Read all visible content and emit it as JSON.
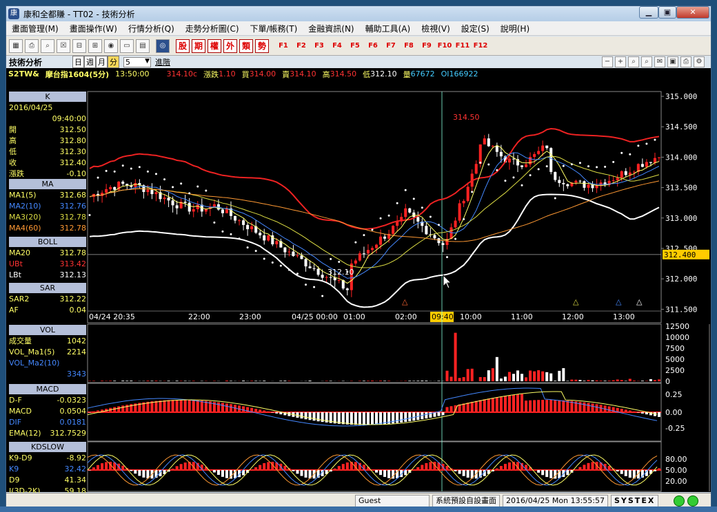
{
  "window": {
    "title": "康和全都賺 - TT02 - 技術分析",
    "app_icon": "康"
  },
  "menu": [
    "畫面管理(M)",
    "畫面操作(W)",
    "行情分析(Q)",
    "走勢分析圖(C)",
    "下單/帳務(T)",
    "金融資訊(N)",
    "輔助工具(A)",
    "檢視(V)",
    "設定(S)",
    "說明(H)"
  ],
  "toolbar": {
    "buttons": [
      "股",
      "期",
      "權",
      "外",
      "類",
      "勢"
    ],
    "fkeys": [
      "F1",
      "F2",
      "F3",
      "F4",
      "F5",
      "F6",
      "F7",
      "F8",
      "F9",
      "F10",
      "F11",
      "F12"
    ]
  },
  "header": {
    "title": "技術分析",
    "periods": [
      "日",
      "週",
      "月",
      "分"
    ],
    "interval": "5",
    "advanced": "進階"
  },
  "quote": {
    "symbol": "S2TW&",
    "name": "摩台指1604(5分)",
    "time": "13:50:00",
    "last": "314.10c",
    "change_label": "漲跌",
    "change": "1.10",
    "buy_label": "買",
    "buy": "314.00",
    "sell_label": "賣",
    "sell": "314.10",
    "high_label": "高",
    "high": "314.50",
    "low_label": "低",
    "low": "312.10",
    "vol_label": "量",
    "vol": "67672",
    "oi_label": "OI",
    "oi": "166922"
  },
  "panel": {
    "k_title": "K",
    "date": "2016/04/25",
    "time": "09:40:00",
    "ohlc": [
      {
        "l": "開",
        "v": "312.50"
      },
      {
        "l": "高",
        "v": "312.80"
      },
      {
        "l": "低",
        "v": "312.30"
      },
      {
        "l": "收",
        "v": "312.40"
      },
      {
        "l": "漲跌",
        "v": "-0.10"
      }
    ],
    "ma_title": "MA",
    "ma": [
      {
        "l": "MA1(5)",
        "v": "312.68",
        "c": "#ffff66"
      },
      {
        "l": "MA2(10)",
        "v": "312.76",
        "c": "#4488ff"
      },
      {
        "l": "MA3(20)",
        "v": "312.78",
        "c": "#dddd44"
      },
      {
        "l": "MA4(60)",
        "v": "312.78",
        "c": "#ff9933"
      }
    ],
    "boll_title": "BOLL",
    "boll": [
      {
        "l": "MA20",
        "v": "312.78",
        "c": "#ffff66"
      },
      {
        "l": "UBt",
        "v": "313.42",
        "c": "#ff3333"
      },
      {
        "l": "LBt",
        "v": "312.13",
        "c": "#ffffff"
      }
    ],
    "sar_title": "SAR",
    "sar": [
      {
        "l": "SAR2",
        "v": "312.22",
        "c": "#ffff66"
      },
      {
        "l": "AF",
        "v": "0.04",
        "c": "#ffff66"
      }
    ],
    "vol_title": "VOL",
    "vol": [
      {
        "l": "成交量",
        "v": "1042",
        "c": "#ffff66"
      },
      {
        "l": "VOL_Ma1(5)",
        "v": "2214",
        "c": "#ffff66"
      },
      {
        "l": "VOL_Ma2(10)",
        "v": "",
        "c": "#4488ff"
      },
      {
        "l": "",
        "v": "3343",
        "c": "#4488ff"
      }
    ],
    "macd_title": "MACD",
    "macd": [
      {
        "l": "D-F",
        "v": "-0.0323",
        "c": "#ffff66"
      },
      {
        "l": "MACD",
        "v": "0.0504",
        "c": "#ffff66"
      },
      {
        "l": "DIF",
        "v": "0.0181",
        "c": "#4488ff"
      },
      {
        "l": "EMA(12)",
        "v": "312.7529",
        "c": "#ffff66"
      }
    ],
    "kd_title": "KDSLOW",
    "kd": [
      {
        "l": "K9-D9",
        "v": "-8.92",
        "c": "#ffff66"
      },
      {
        "l": "K9",
        "v": "32.42",
        "c": "#4488ff"
      },
      {
        "l": "D9",
        "v": "41.34",
        "c": "#ffff66"
      },
      {
        "l": "J(3D-2K)",
        "v": "59.18",
        "c": "#ffff66"
      }
    ]
  },
  "price_axis": [
    "315.000",
    "314.500",
    "314.000",
    "313.500",
    "313.000",
    "312.500",
    "312.000",
    "311.500"
  ],
  "current_price": "312.400",
  "vol_axis": [
    "12500",
    "10000",
    "7500",
    "5000",
    "2500",
    "0"
  ],
  "macd_axis": [
    "0.25",
    "0.00",
    "-0.25"
  ],
  "kd_axis": [
    "80.00",
    "50.00",
    "20.00"
  ],
  "time_axis": [
    "04/24 20:35",
    "22:00",
    "23:00",
    "04/25 00:00",
    "01:00",
    "02:00",
    "09:40",
    "10:00",
    "11:00",
    "12:00",
    "13:00"
  ],
  "annotations": {
    "high": "314.50",
    "low": "312.10"
  },
  "status": {
    "user": "Guest",
    "layout": "系統預設自設畫面",
    "datetime": "2016/04/25 Mon 13:55:57",
    "brand": "SYSTEX"
  }
}
